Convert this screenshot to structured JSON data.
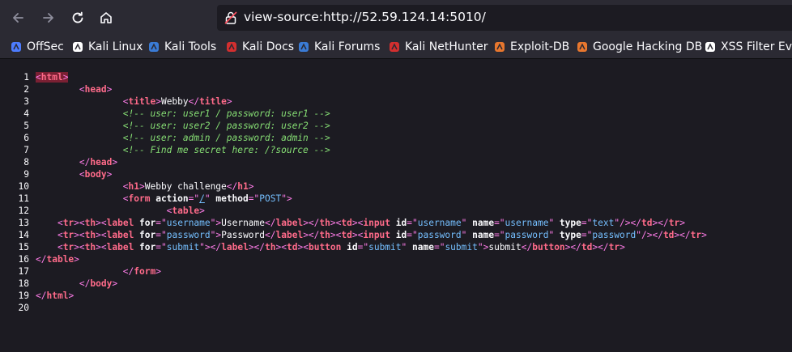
{
  "browser": {
    "url": "view-source:http://52.59.124.14:5010/",
    "nav": [
      "back-icon",
      "forward-icon",
      "reload-icon",
      "home-icon"
    ]
  },
  "bookmarks": [
    {
      "label": "OffSec",
      "icon": "offsec-icon",
      "color": "#4d7cff"
    },
    {
      "label": "Kali Linux",
      "icon": "kali-dragon-icon",
      "color": "#ffffff"
    },
    {
      "label": "Kali Tools",
      "icon": "kali-tools-icon",
      "color": "#3a7bd5"
    },
    {
      "label": "Kali Docs",
      "icon": "kali-docs-icon",
      "color": "#d32f2f"
    },
    {
      "label": "Kali Forums",
      "icon": "kali-forums-icon",
      "color": "#3a7bd5"
    },
    {
      "label": "Kali NetHunter",
      "icon": "nethunter-icon",
      "color": "#d32f2f"
    },
    {
      "label": "Exploit-DB",
      "icon": "exploit-db-icon",
      "color": "#e8772e"
    },
    {
      "label": "Google Hacking DB",
      "icon": "ghdb-icon",
      "color": "#e8772e"
    },
    {
      "label": "XSS Filter Eva",
      "icon": "xss-icon",
      "color": "#ffffff"
    }
  ],
  "source": {
    "line_numbers": [
      "1",
      "2",
      "3",
      "4",
      "5",
      "6",
      "7",
      "8",
      "9",
      "10",
      "11",
      "12",
      "13",
      "14",
      "15",
      "16",
      "17",
      "18",
      "19",
      "20"
    ],
    "lines": [
      [
        {
          "t": "<",
          "c": "tag hl"
        },
        {
          "t": "html",
          "c": "tagname hl"
        },
        {
          "t": ">",
          "c": "tag hl"
        }
      ],
      [
        {
          "t": "        <",
          "c": "tag"
        },
        {
          "t": "head",
          "c": "tagname"
        },
        {
          "t": ">",
          "c": "tag"
        }
      ],
      [
        {
          "t": "                <",
          "c": "tag"
        },
        {
          "t": "title",
          "c": "tagname"
        },
        {
          "t": ">",
          "c": "tag"
        },
        {
          "t": "Webby",
          "c": "txt"
        },
        {
          "t": "</",
          "c": "tag"
        },
        {
          "t": "title",
          "c": "tagname"
        },
        {
          "t": ">",
          "c": "tag"
        }
      ],
      [
        {
          "t": "                <!-- user: user1 / password: user1 -->",
          "c": "comment"
        }
      ],
      [
        {
          "t": "                <!-- user: user2 / password: user2 -->",
          "c": "comment"
        }
      ],
      [
        {
          "t": "                <!-- user: admin / password: admin -->",
          "c": "comment"
        }
      ],
      [
        {
          "t": "                <!-- Find me secret here: /?source -->",
          "c": "comment"
        }
      ],
      [
        {
          "t": "        </",
          "c": "tag"
        },
        {
          "t": "head",
          "c": "tagname"
        },
        {
          "t": ">",
          "c": "tag"
        }
      ],
      [
        {
          "t": "        <",
          "c": "tag"
        },
        {
          "t": "body",
          "c": "tagname"
        },
        {
          "t": ">",
          "c": "tag"
        }
      ],
      [
        {
          "t": "                <",
          "c": "tag"
        },
        {
          "t": "h1",
          "c": "tagname"
        },
        {
          "t": ">",
          "c": "tag"
        },
        {
          "t": "Webby challenge",
          "c": "txt"
        },
        {
          "t": "</",
          "c": "tag"
        },
        {
          "t": "h1",
          "c": "tagname"
        },
        {
          "t": ">",
          "c": "tag"
        }
      ],
      [
        {
          "t": "                <",
          "c": "tag"
        },
        {
          "t": "form",
          "c": "tagname"
        },
        {
          "t": " action",
          "c": "attr"
        },
        {
          "t": "=\"",
          "c": "tag"
        },
        {
          "t": "/",
          "c": "val uline"
        },
        {
          "t": "\"",
          "c": "tag"
        },
        {
          "t": " method",
          "c": "attr"
        },
        {
          "t": "=\"",
          "c": "tag"
        },
        {
          "t": "POST",
          "c": "val"
        },
        {
          "t": "\">",
          "c": "tag"
        }
      ],
      [
        {
          "t": "                        <",
          "c": "tag"
        },
        {
          "t": "table",
          "c": "tagname"
        },
        {
          "t": ">",
          "c": "tag"
        }
      ],
      [
        {
          "t": "    <",
          "c": "tag"
        },
        {
          "t": "tr",
          "c": "tagname"
        },
        {
          "t": "><",
          "c": "tag"
        },
        {
          "t": "th",
          "c": "tagname"
        },
        {
          "t": "><",
          "c": "tag"
        },
        {
          "t": "label",
          "c": "tagname"
        },
        {
          "t": " for",
          "c": "attr"
        },
        {
          "t": "=\"",
          "c": "tag"
        },
        {
          "t": "username",
          "c": "val"
        },
        {
          "t": "\">",
          "c": "tag"
        },
        {
          "t": "Username",
          "c": "txt"
        },
        {
          "t": "</",
          "c": "tag"
        },
        {
          "t": "label",
          "c": "tagname"
        },
        {
          "t": "></",
          "c": "tag"
        },
        {
          "t": "th",
          "c": "tagname"
        },
        {
          "t": "><",
          "c": "tag"
        },
        {
          "t": "td",
          "c": "tagname"
        },
        {
          "t": "><",
          "c": "tag"
        },
        {
          "t": "input",
          "c": "tagname"
        },
        {
          "t": " id",
          "c": "attr"
        },
        {
          "t": "=\"",
          "c": "tag"
        },
        {
          "t": "username",
          "c": "val"
        },
        {
          "t": "\"",
          "c": "tag"
        },
        {
          "t": " name",
          "c": "attr"
        },
        {
          "t": "=\"",
          "c": "tag"
        },
        {
          "t": "username",
          "c": "val"
        },
        {
          "t": "\"",
          "c": "tag"
        },
        {
          "t": " type",
          "c": "attr"
        },
        {
          "t": "=\"",
          "c": "tag"
        },
        {
          "t": "text",
          "c": "val"
        },
        {
          "t": "\"/></",
          "c": "tag"
        },
        {
          "t": "td",
          "c": "tagname"
        },
        {
          "t": "></",
          "c": "tag"
        },
        {
          "t": "tr",
          "c": "tagname"
        },
        {
          "t": ">",
          "c": "tag"
        }
      ],
      [
        {
          "t": "    <",
          "c": "tag"
        },
        {
          "t": "tr",
          "c": "tagname"
        },
        {
          "t": "><",
          "c": "tag"
        },
        {
          "t": "th",
          "c": "tagname"
        },
        {
          "t": "><",
          "c": "tag"
        },
        {
          "t": "label",
          "c": "tagname"
        },
        {
          "t": " for",
          "c": "attr"
        },
        {
          "t": "=\"",
          "c": "tag"
        },
        {
          "t": "password",
          "c": "val"
        },
        {
          "t": "\">",
          "c": "tag"
        },
        {
          "t": "Password",
          "c": "txt"
        },
        {
          "t": "</",
          "c": "tag"
        },
        {
          "t": "label",
          "c": "tagname"
        },
        {
          "t": "></",
          "c": "tag"
        },
        {
          "t": "th",
          "c": "tagname"
        },
        {
          "t": "><",
          "c": "tag"
        },
        {
          "t": "td",
          "c": "tagname"
        },
        {
          "t": "><",
          "c": "tag"
        },
        {
          "t": "input",
          "c": "tagname"
        },
        {
          "t": " id",
          "c": "attr"
        },
        {
          "t": "=\"",
          "c": "tag"
        },
        {
          "t": "password",
          "c": "val"
        },
        {
          "t": "\"",
          "c": "tag"
        },
        {
          "t": " name",
          "c": "attr"
        },
        {
          "t": "=\"",
          "c": "tag"
        },
        {
          "t": "password",
          "c": "val"
        },
        {
          "t": "\"",
          "c": "tag"
        },
        {
          "t": " type",
          "c": "attr"
        },
        {
          "t": "=\"",
          "c": "tag"
        },
        {
          "t": "password",
          "c": "val"
        },
        {
          "t": "\"/></",
          "c": "tag"
        },
        {
          "t": "td",
          "c": "tagname"
        },
        {
          "t": "></",
          "c": "tag"
        },
        {
          "t": "tr",
          "c": "tagname"
        },
        {
          "t": ">",
          "c": "tag"
        }
      ],
      [
        {
          "t": "    <",
          "c": "tag"
        },
        {
          "t": "tr",
          "c": "tagname"
        },
        {
          "t": "><",
          "c": "tag"
        },
        {
          "t": "th",
          "c": "tagname"
        },
        {
          "t": "><",
          "c": "tag"
        },
        {
          "t": "label",
          "c": "tagname"
        },
        {
          "t": " for",
          "c": "attr"
        },
        {
          "t": "=\"",
          "c": "tag"
        },
        {
          "t": "submit",
          "c": "val"
        },
        {
          "t": "\"></",
          "c": "tag"
        },
        {
          "t": "label",
          "c": "tagname"
        },
        {
          "t": "></",
          "c": "tag"
        },
        {
          "t": "th",
          "c": "tagname"
        },
        {
          "t": "><",
          "c": "tag"
        },
        {
          "t": "td",
          "c": "tagname"
        },
        {
          "t": "><",
          "c": "tag"
        },
        {
          "t": "button",
          "c": "tagname"
        },
        {
          "t": " id",
          "c": "attr"
        },
        {
          "t": "=\"",
          "c": "tag"
        },
        {
          "t": "submit",
          "c": "val"
        },
        {
          "t": "\"",
          "c": "tag"
        },
        {
          "t": " name",
          "c": "attr"
        },
        {
          "t": "=\"",
          "c": "tag"
        },
        {
          "t": "submit",
          "c": "val"
        },
        {
          "t": "\">",
          "c": "tag"
        },
        {
          "t": "submit",
          "c": "txt"
        },
        {
          "t": "</",
          "c": "tag"
        },
        {
          "t": "button",
          "c": "tagname"
        },
        {
          "t": "></",
          "c": "tag"
        },
        {
          "t": "td",
          "c": "tagname"
        },
        {
          "t": "></",
          "c": "tag"
        },
        {
          "t": "tr",
          "c": "tagname"
        },
        {
          "t": ">",
          "c": "tag"
        }
      ],
      [
        {
          "t": "</",
          "c": "tag"
        },
        {
          "t": "table",
          "c": "tagname"
        },
        {
          "t": ">",
          "c": "tag"
        }
      ],
      [
        {
          "t": "                </",
          "c": "tag"
        },
        {
          "t": "form",
          "c": "tagname"
        },
        {
          "t": ">",
          "c": "tag"
        }
      ],
      [
        {
          "t": "        </",
          "c": "tag"
        },
        {
          "t": "body",
          "c": "tagname"
        },
        {
          "t": ">",
          "c": "tag"
        }
      ],
      [
        {
          "t": "</",
          "c": "tag"
        },
        {
          "t": "html",
          "c": "tagname"
        },
        {
          "t": ">",
          "c": "tag"
        }
      ],
      []
    ]
  }
}
